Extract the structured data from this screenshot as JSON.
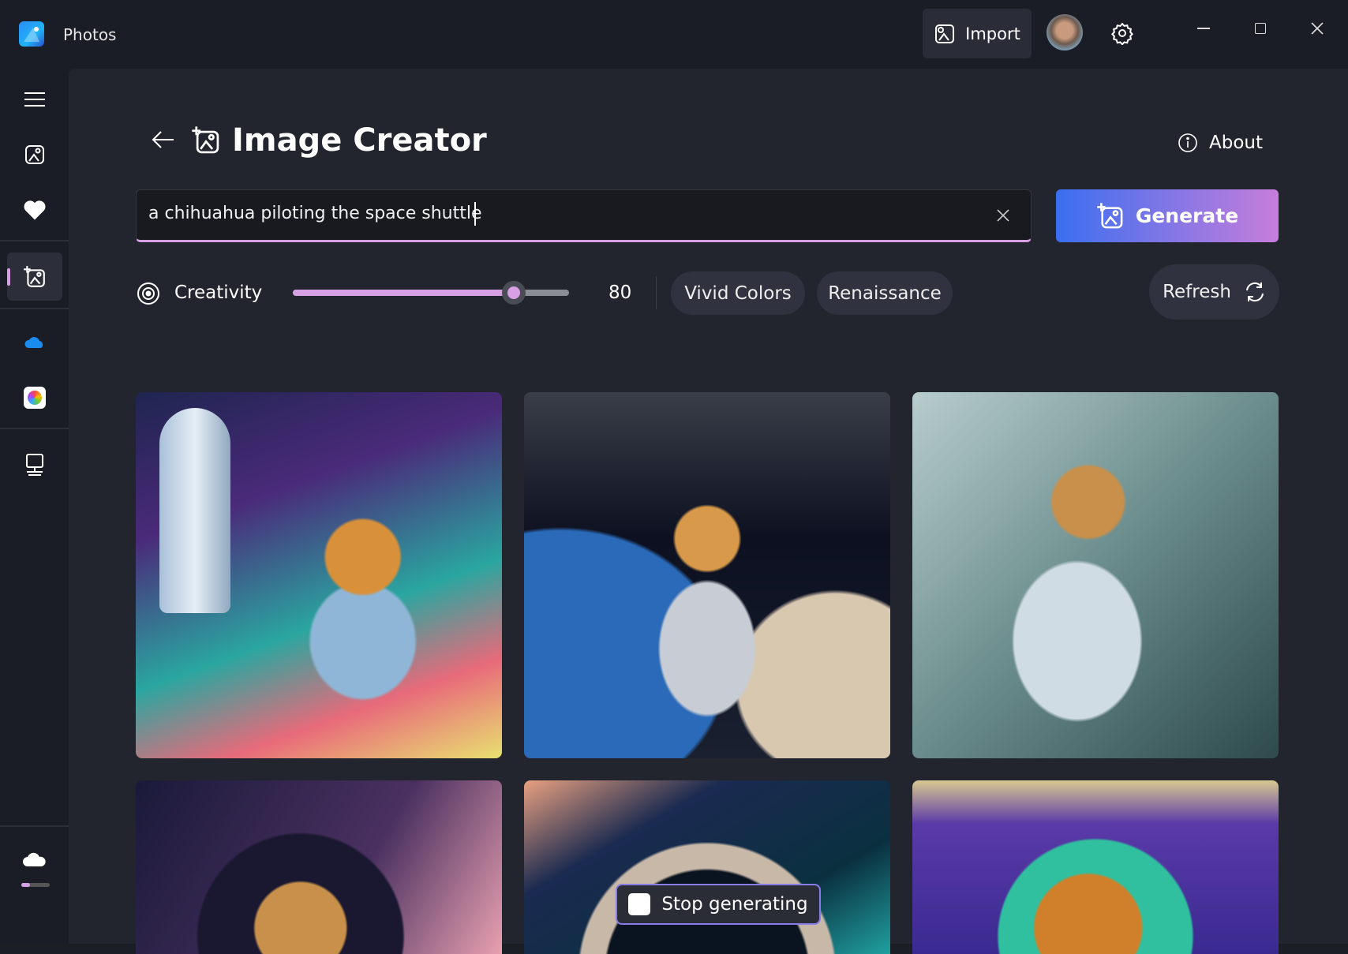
{
  "app": {
    "title": "Photos"
  },
  "titlebar": {
    "import_label": "Import"
  },
  "page": {
    "title": "Image Creator",
    "about_label": "About"
  },
  "prompt": {
    "value": "a chihuahua piloting the space shuttle",
    "placeholder": ""
  },
  "generate_label": "Generate",
  "creativity": {
    "label": "Creativity",
    "value": 80,
    "value_text": "80",
    "min": 0,
    "max": 100
  },
  "styles": [
    {
      "label": "Vivid Colors"
    },
    {
      "label": "Renaissance"
    }
  ],
  "refresh_label": "Refresh",
  "stop_label": "Stop generating",
  "colors": {
    "accent_start": "#3b6ff0",
    "accent_end": "#c77ddb",
    "slider": "#d79fe4"
  }
}
